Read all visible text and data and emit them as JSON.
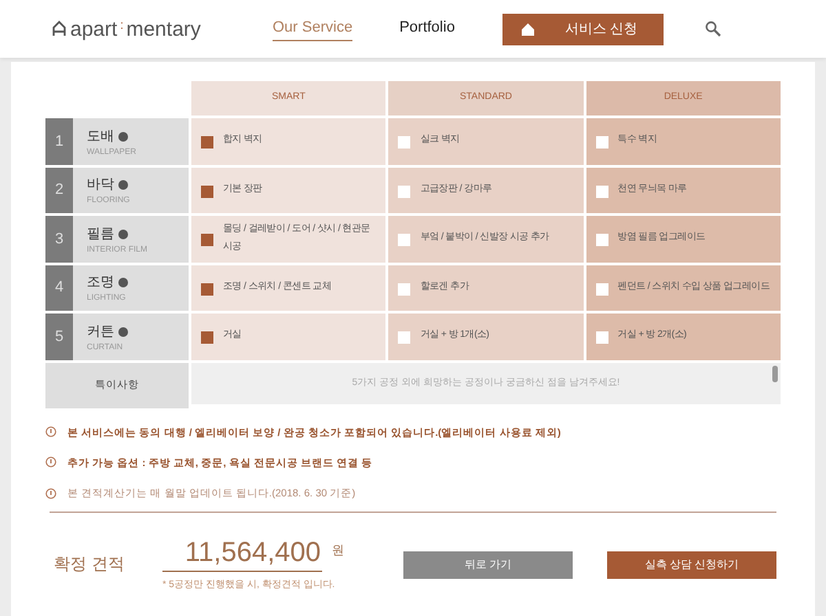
{
  "header": {
    "logo": {
      "left": "apart",
      "separator": ":",
      "right": "mentary"
    },
    "nav": [
      {
        "label": "Our Service",
        "selected": true
      },
      {
        "label": "Portfolio",
        "selected": false
      }
    ],
    "apply_button": "서비스 신청"
  },
  "plans": [
    "SMART",
    "STANDARD",
    "DELUXE"
  ],
  "rows": [
    {
      "number": "1",
      "name": "도배",
      "subtitle": "WALLPAPER",
      "options": [
        {
          "label": "합지 벽지",
          "checked": true
        },
        {
          "label": "실크 벽지",
          "checked": false
        },
        {
          "label": "특수 벽지",
          "checked": false
        }
      ]
    },
    {
      "number": "2",
      "name": "바닥",
      "subtitle": "FLOORING",
      "options": [
        {
          "label": "기본 장판",
          "checked": true
        },
        {
          "label": "고급장판 / 강마루",
          "checked": false
        },
        {
          "label": "천연 무늬목 마루",
          "checked": false
        }
      ]
    },
    {
      "number": "3",
      "name": "필름",
      "subtitle": "INTERIOR FILM",
      "options": [
        {
          "label": "몰딩 / 걸레받이 / 도어 / 샷시 / 현관문 시공",
          "checked": true
        },
        {
          "label": "부엌 / 붙박이 / 신발장 시공 추가",
          "checked": false
        },
        {
          "label": "방염 필름 업그레이드",
          "checked": false
        }
      ]
    },
    {
      "number": "4",
      "name": "조명",
      "subtitle": "LIGHTING",
      "options": [
        {
          "label": "조명 / 스위치 / 콘센트 교체",
          "checked": true
        },
        {
          "label": "할로겐 추가",
          "checked": false
        },
        {
          "label": "펜던트 / 스위치 수입 상품 업그레이드",
          "checked": false
        }
      ]
    },
    {
      "number": "5",
      "name": "커튼",
      "subtitle": "CURTAIN",
      "options": [
        {
          "label": "거실",
          "checked": true
        },
        {
          "label": "거실 + 방 1개(소)",
          "checked": false
        },
        {
          "label": "거실 + 방 2개(소)",
          "checked": false
        }
      ]
    }
  ],
  "remarks": {
    "label": "특이사항",
    "placeholder": "5가지 공정 외에 희망하는 공정이나 궁금하신 점을 남겨주세요!"
  },
  "notes": [
    {
      "text": "본 서비스에는 동의 대행 / 엘리베이터 보양 / 완공 청소가 포함되어 있습니다.(엘리베이터 사용료 제외)",
      "emphasis": true
    },
    {
      "text": "추가 가능 옵션 : 주방 교체, 중문, 욕실 전문시공 브랜드 연결 등",
      "emphasis": true
    },
    {
      "text": "본 견적계산기는 매 월말 업데이트 됩니다.(2018. 6. 30 기준)",
      "emphasis": false
    }
  ],
  "estimate": {
    "label": "확정 견적",
    "amount": "11,564,400",
    "unit": "원",
    "footnote": "* 5공정만 진행했을 시, 확정견적 입니다."
  },
  "buttons": [
    {
      "label": "뒤로 가기",
      "kind": "secondary"
    },
    {
      "label": "실측 상담 신청하기",
      "kind": "primary"
    }
  ]
}
